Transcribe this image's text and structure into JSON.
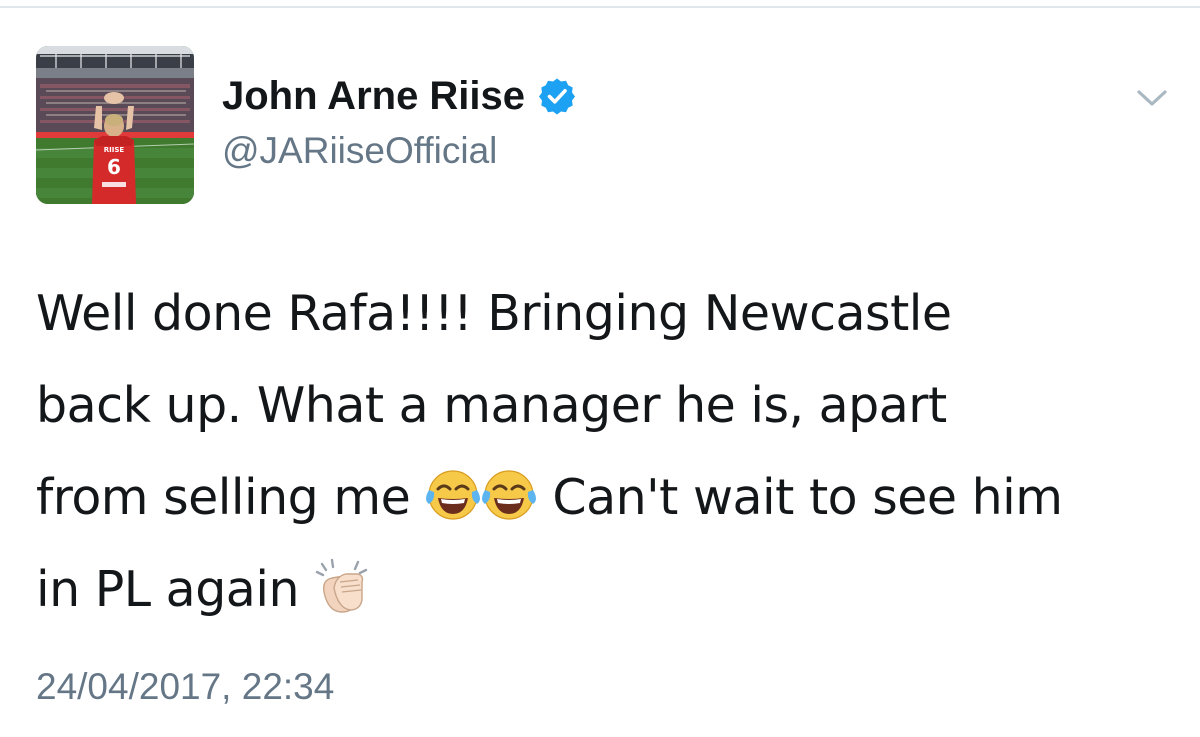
{
  "tweet": {
    "author": {
      "display_name": "John Arne Riise",
      "handle": "@JARiiseOfficial",
      "verified": true,
      "avatar_icon": "player-avatar",
      "jersey_name": "RIISE",
      "jersey_number": "6"
    },
    "menu_icon": "chevron-down-icon",
    "text_lines": {
      "line1": "Well done Rafa!!!! Bringing Newcastle",
      "line2": "back up.  What a manager he is, apart",
      "line3_before": "from selling me ",
      "line3_after": " Can't wait to see him",
      "line4": "in PL again "
    },
    "emojis": [
      "face-with-tears-of-joy",
      "face-with-tears-of-joy",
      "clapping-hands-light-skin"
    ],
    "timestamp": "24/04/2017, 22:34"
  },
  "colors": {
    "text_primary": "#14171a",
    "text_secondary": "#657786",
    "verified_blue": "#1da1f2",
    "divider": "#e1e8ed"
  }
}
